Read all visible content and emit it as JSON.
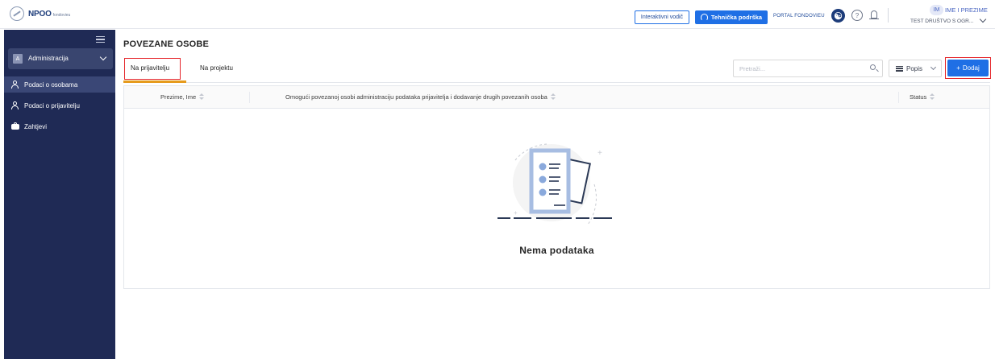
{
  "app": {
    "logo_text": "NPOO",
    "logo_sub": "fondovieu"
  },
  "header": {
    "guide_button": "Interaktivni vodič",
    "support_button": "Tehnička podrška",
    "portal_link": "PORTAL FONDOVIEU",
    "user_initials": "IM",
    "user_name": "IME I PREZIME",
    "company": "TEST DRUŠTVO S OGR..."
  },
  "sidebar": {
    "org_avatar": "A",
    "org_label": "Administracija",
    "items": [
      {
        "label": "Podaci o osobama",
        "icon": "person-icon",
        "active": true
      },
      {
        "label": "Podaci o prijavitelju",
        "icon": "person-icon",
        "active": false
      },
      {
        "label": "Zahtjevi",
        "icon": "tickets-icon",
        "active": false
      }
    ]
  },
  "main": {
    "title": "POVEZANE OSOBE",
    "tabs": [
      {
        "label": "Na prijavitelju",
        "active": true
      },
      {
        "label": "Na projektu",
        "active": false
      }
    ],
    "search_placeholder": "Pretraži...",
    "view_label": "Popis",
    "add_label": "Dodaj",
    "add_plus": "+",
    "table": {
      "columns": [
        "Prezime, Ime",
        "Omogući povezanoj osobi administraciju podataka prijavitelja i dodavanje drugih povezanih osoba",
        "Status"
      ],
      "rows": [],
      "empty_text": "Nema podataka"
    }
  },
  "colors": {
    "sidebar_bg": "#1f2a55",
    "primary": "#1f6fe5",
    "tab_underline": "#e69b1d",
    "highlight": "#e5262b"
  }
}
